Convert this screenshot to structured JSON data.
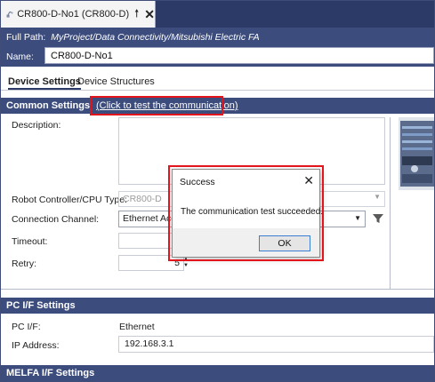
{
  "tab": {
    "title": "CR800-D-No1 (CR800-D)",
    "pin_glyph": "🠕",
    "close_glyph": "✕"
  },
  "header": {
    "path_label": "Full Path:",
    "path_value": "MyProject/Data Connectivity/Mitsubishi Electric FA",
    "name_label": "Name:",
    "name_value": "CR800-D-No1"
  },
  "subtabs": [
    {
      "label": "Device Settings",
      "active": true
    },
    {
      "label": "Device Structures",
      "active": false
    }
  ],
  "common": {
    "title": "Common Settings",
    "test_link": "(Click to test the communication)",
    "description_label": "Description:",
    "robot_label": "Robot Controller/CPU Type:",
    "robot_value": "CR800-D",
    "channel_label": "Connection Channel:",
    "channel_value": "Ethernet Acc",
    "timeout_label": "Timeout:",
    "timeout_value": "",
    "retry_label": "Retry:",
    "retry_value": "5"
  },
  "pc": {
    "title": "PC I/F Settings",
    "if_label": "PC I/F:",
    "if_value": "Ethernet",
    "ip_label": "IP Address:",
    "ip_value": "192.168.3.1"
  },
  "melfa": {
    "title": "MELFA I/F Settings"
  },
  "dialog": {
    "title": "Success",
    "message": "The communication test succeeded.",
    "ok_label": "OK",
    "close_glyph": "✕"
  },
  "colors": {
    "header_navy": "#2b3a67",
    "section_blue": "#3c4c7d",
    "highlight_red": "#e3141b",
    "ok_border": "#3c7fd2"
  }
}
